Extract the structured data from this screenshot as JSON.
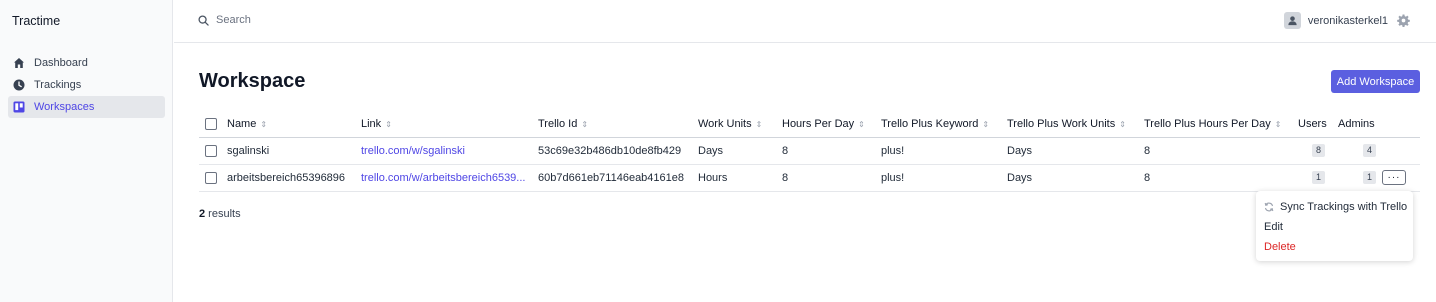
{
  "app": {
    "name": "Tractime"
  },
  "sidebar": {
    "items": [
      {
        "label": "Dashboard",
        "icon": "home-icon",
        "active": false
      },
      {
        "label": "Trackings",
        "icon": "clock-icon",
        "active": false
      },
      {
        "label": "Workspaces",
        "icon": "board-icon",
        "active": true
      }
    ]
  },
  "topbar": {
    "search_label": "Search",
    "username": "veronikasterkel1"
  },
  "page": {
    "title": "Workspace",
    "add_button": "Add Workspace",
    "results_count": "2",
    "results_label": " results"
  },
  "table": {
    "columns": {
      "name": "Name",
      "link": "Link",
      "trello_id": "Trello Id",
      "work_units": "Work Units",
      "hours_per_day": "Hours Per Day",
      "plus_keyword": "Trello Plus Keyword",
      "plus_work_units": "Trello Plus Work Units",
      "plus_hours_per_day": "Trello Plus Hours Per Day",
      "users": "Users",
      "admins": "Admins"
    },
    "rows": [
      {
        "name": "sgalinski",
        "link": "trello.com/w/sgalinski",
        "trello_id": "53c69e32b486db10de8fb429",
        "work_units": "Days",
        "hours_per_day": "8",
        "plus_keyword": "plus!",
        "plus_work_units": "Days",
        "plus_hours_per_day": "8",
        "users": "8",
        "admins": "4"
      },
      {
        "name": "arbeitsbereich65396896",
        "link": "trello.com/w/arbeitsbereich6539...",
        "trello_id": "60b7d661eb71146eab4161e8",
        "work_units": "Hours",
        "hours_per_day": "8",
        "plus_keyword": "plus!",
        "plus_work_units": "Days",
        "plus_hours_per_day": "8",
        "users": "1",
        "admins": "1"
      }
    ],
    "row_menu_label": "···"
  },
  "row_menu": {
    "sync": "Sync Trackings with Trello",
    "edit": "Edit",
    "delete": "Delete"
  },
  "colors": {
    "accent": "#5b5fe0",
    "link": "#4f46e5",
    "danger": "#dc2626"
  }
}
